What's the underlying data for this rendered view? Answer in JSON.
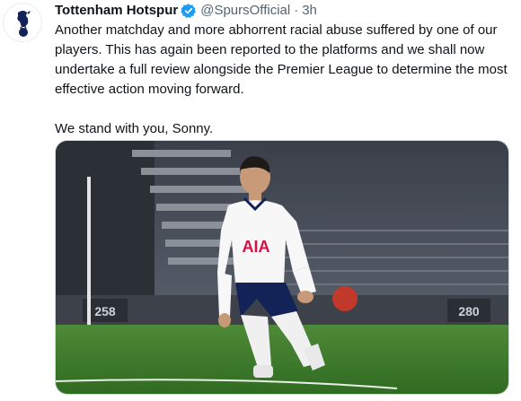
{
  "tweet": {
    "display_name": "Tottenham Hotspur",
    "handle": "@SpursOfficial",
    "separator": "·",
    "time": "3h",
    "paragraphs": [
      "Another matchday and more abhorrent racial abuse suffered by one of our players. This has again been reported to the platforms and we shall now undertake a full review alongside the Premier League to determine the most effective action moving forward.",
      "We stand with you, Sonny."
    ]
  },
  "media": {
    "shirt_sponsor": "AIA",
    "stand_sign_left": "258",
    "stand_sign_right": "280"
  },
  "icons": {
    "avatar": "spurs-crest-icon",
    "verified": "verified-badge-icon"
  },
  "colors": {
    "verified_blue": "#1d9bf0",
    "spurs_navy": "#132257",
    "pitch_green": "#3e7d2a",
    "sponsor_red": "#d31145",
    "muted_text": "#536471"
  }
}
